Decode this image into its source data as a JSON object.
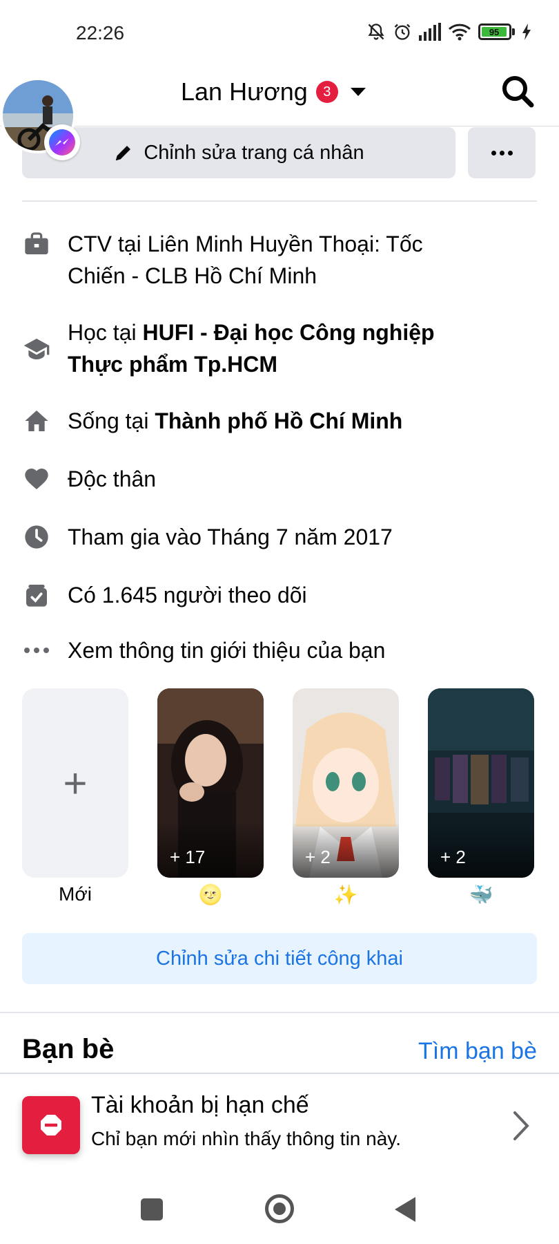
{
  "status_bar": {
    "time": "22:26",
    "battery_level": "95",
    "icons": [
      "muted-bell-icon",
      "alarm-icon",
      "signal-icon",
      "wifi-icon",
      "battery-icon",
      "charging-icon"
    ]
  },
  "header": {
    "name": "Lan Hương",
    "notification_count": "3"
  },
  "actions": {
    "edit_profile_label": "Chỉnh sửa trang cá nhân"
  },
  "intro": {
    "work_line1": "CTV tại Liên Minh Huyền Thoại: Tốc",
    "work_line2": "Chiến - CLB Hồ Chí Minh",
    "study_prefix": "Học tại ",
    "study_line1": "HUFI - Đại học Công nghiệp",
    "study_line2": "Thực phẩm Tp.HCM",
    "live_prefix": "Sống tại ",
    "live_place": "Thành phố Hồ Chí Minh",
    "relationship": "Độc thân",
    "joined": "Tham gia vào Tháng 7 năm 2017",
    "followers": "Có 1.645 người theo dõi",
    "see_more": "Xem thông tin giới thiệu của bạn"
  },
  "featured": {
    "new_label": "Mới",
    "items": [
      {
        "count": "+ 17",
        "caption": "🌝"
      },
      {
        "count": "+ 2",
        "caption": "✨"
      },
      {
        "count": "+ 2",
        "caption": "🐳"
      }
    ]
  },
  "edit_public_label": "Chỉnh sửa chi tiết công khai",
  "friends": {
    "title": "Bạn bè",
    "find_label": "Tìm bạn bè"
  },
  "restricted": {
    "title": "Tài khoản bị hạn chế",
    "subtitle": "Chỉ bạn mới nhìn thấy thông tin này."
  },
  "colors": {
    "accent": "#1b74e4",
    "button_bg": "#e4e6eb",
    "light_blue_bg": "#e7f3ff",
    "badge_red": "#e41e3f"
  }
}
